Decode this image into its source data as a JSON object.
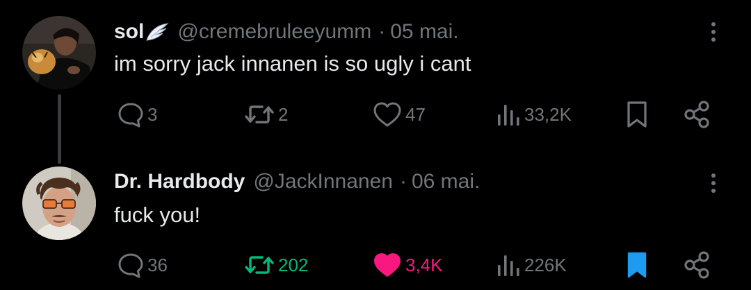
{
  "colors": {
    "background": "#000000",
    "text_primary": "#e7e9ea",
    "text_secondary": "#71767b",
    "retweet_active": "#00ba7c",
    "like_active": "#f91880",
    "bookmark_active": "#1d9bf0"
  },
  "tweets": [
    {
      "display_name": "sol",
      "badge_icon": "angel-wing-icon",
      "handle": "@cremebruleeyumm",
      "separator": "·",
      "date": "05 mai.",
      "text": "im sorry jack innanen is so ugly i cant",
      "stats": {
        "replies": "3",
        "retweets": "2",
        "likes": "47",
        "views": "33,2K"
      },
      "state": {
        "retweeted": false,
        "liked": false,
        "bookmarked": false
      }
    },
    {
      "display_name": "Dr. Hardbody",
      "handle": "@JackInnanen",
      "separator": "·",
      "date": "06 mai.",
      "text": "fuck you!",
      "stats": {
        "replies": "36",
        "retweets": "202",
        "likes": "3,4K",
        "views": "226K"
      },
      "state": {
        "retweeted": true,
        "liked": true,
        "bookmarked": true
      }
    }
  ]
}
